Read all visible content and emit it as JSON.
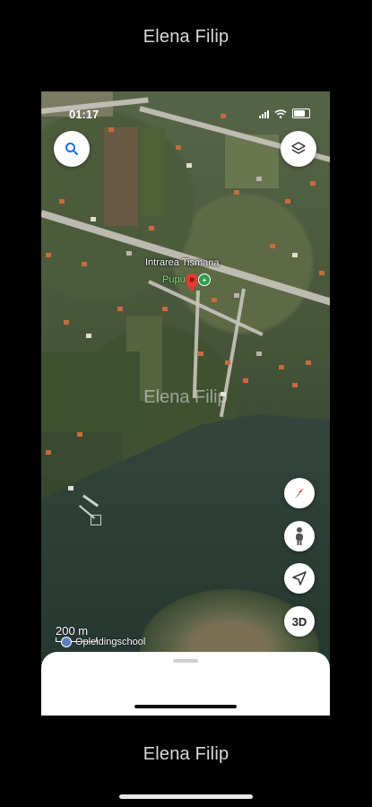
{
  "watermark": {
    "text": "Elena Filip"
  },
  "status_bar": {
    "time": "01:17"
  },
  "map": {
    "street_label": "Intrarea Tismana",
    "place_label": "Pupu",
    "scale_label": "200 m",
    "poi_label": "Opleidingschool",
    "overlay_watermark": "Elena Filip"
  },
  "buttons": {
    "threed_label": "3D"
  },
  "icons": {
    "search": "search-icon",
    "layers": "layers-icon",
    "compass": "compass-icon",
    "pegman": "street-view-pegman-icon",
    "location": "my-location-arrow-icon",
    "pin": "map-pin-icon"
  },
  "colors": {
    "pin_red": "#e53935",
    "place_green": "#2e9d4a",
    "accent_blue": "#1a73e8"
  }
}
